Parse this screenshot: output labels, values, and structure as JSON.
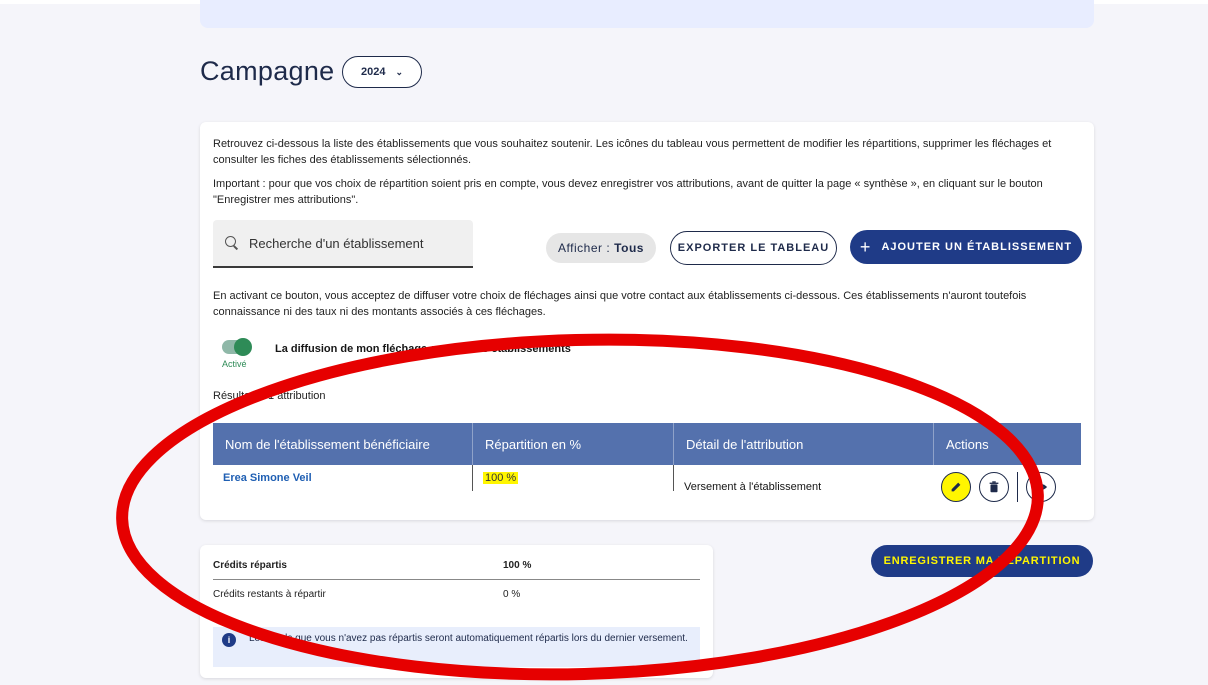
{
  "page": {
    "title": "Campagne",
    "year_selected": "2024"
  },
  "intro": {
    "paragraph1": "Retrouvez ci-dessous la liste des établissements que vous souhaitez soutenir. Les icônes du tableau vous permettent de modifier les répartitions, supprimer les fléchages et consulter les fiches des établissements sélectionnés.",
    "paragraph2": "Important : pour que vos choix de répartition soient pris en compte, vous devez enregistrer vos attributions, avant de quitter la page « synthèse », en cliquant sur le bouton \"Enregistrer mes attributions\"."
  },
  "toolbar": {
    "search_placeholder": "Recherche d'un établissement",
    "filter_label": "Afficher :",
    "filter_value": "Tous",
    "export_label": "EXPORTER LE TABLEAU",
    "add_label": "AJOUTER UN ÉTABLISSEMENT"
  },
  "consent": {
    "text": "En activant ce bouton, vous acceptez de diffuser votre choix de fléchages ainsi que votre contact aux établissements ci-dessous. Ces établissements n'auront toutefois connaissance ni des taux ni des montants associés à ces fléchages.",
    "toggle_state": "Activé",
    "toggle_label": "La diffusion de mon fléchage auprès des établissements"
  },
  "results": "Résultats : 1 attribution",
  "table": {
    "headers": [
      "Nom de l'établissement bénéficiaire",
      "Répartition en %",
      "Détail de l'attribution",
      "Actions"
    ],
    "rows": [
      {
        "name": "Erea Simone Veil",
        "percent": "100 %",
        "detail": "Versement à l'établissement"
      }
    ]
  },
  "save_label": "ENREGISTRER MA RÉPARTITION",
  "summary": {
    "row1_label": "Crédits répartis",
    "row1_value": "100 %",
    "row2_label": "Crédits restants à répartir",
    "row2_value": "0 %",
    "info": "Les fonds que vous n'avez pas répartis seront automatiquement répartis lors du dernier versement."
  },
  "colors": {
    "primary": "#1f3b87",
    "table_header": "#5471ad",
    "highlight": "#fff600",
    "annotation": "#e60000"
  }
}
